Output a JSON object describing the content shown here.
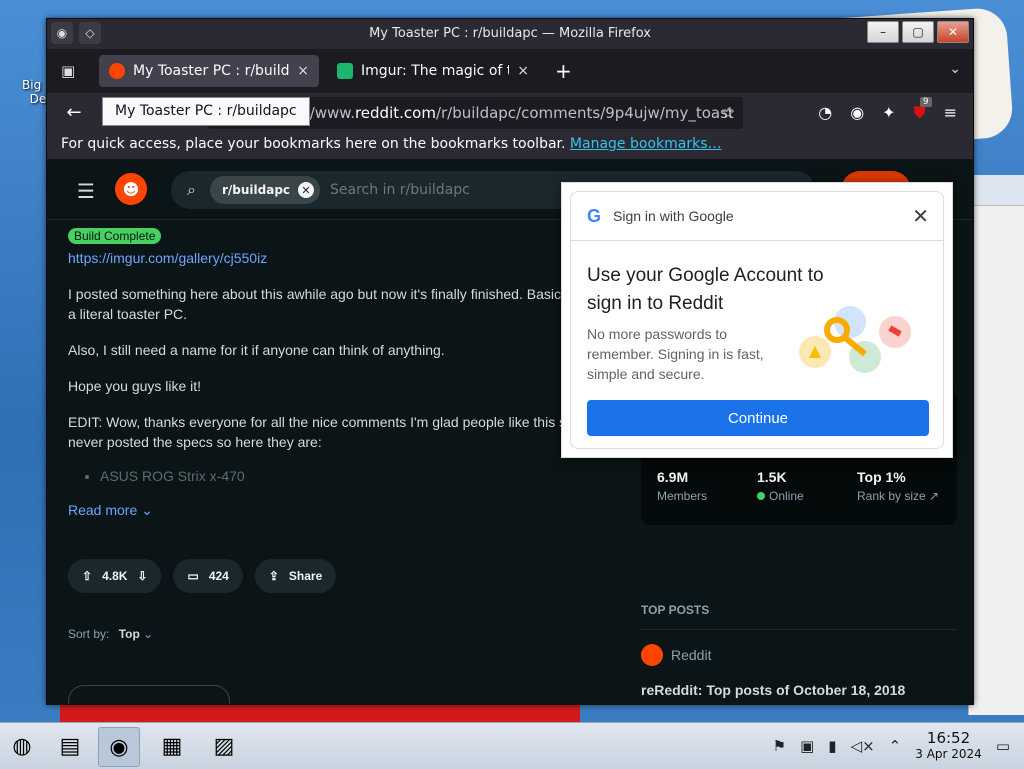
{
  "window": {
    "title": "My Toaster PC : r/buildapc — Mozilla Firefox",
    "buttons": [
      "–",
      "▢",
      "✕"
    ]
  },
  "tabs": [
    {
      "label": "My Toaster PC : r/buildapc",
      "close": "×",
      "favicon_color": "#ff4500"
    },
    {
      "label": "Imgur: The magic of the Internet",
      "close": "×",
      "favicon_color": "#1bb76e"
    }
  ],
  "new_tab": "+",
  "url": {
    "prefix": "https://www.",
    "host": "reddit.com",
    "path": "/r/buildapc/comments/9p4ujw/my_toast"
  },
  "tooltip": "My Toaster PC : r/buildapc",
  "extension_badge": "9",
  "bookmarks_bar": {
    "text": "For quick access, place your bookmarks here on the bookmarks toolbar.",
    "link": "Manage bookmarks…"
  },
  "reddit": {
    "search_chip": "r/buildapc",
    "search_placeholder": "Search in r/buildapc",
    "post": {
      "flair": "Build Complete",
      "link": "https://imgur.com/gallery/cj550iz",
      "paragraphs": [
        "I posted something here about this awhile ago but now it's finally finished. Basic",
        "a literal toaster PC.",
        "Also, I still need a name for it if anyone can think of anything.",
        "Hope you guys like it!",
        "EDIT: Wow, thanks everyone for all the nice comments I'm glad people like this s",
        "never posted the specs so here they are:"
      ],
      "spec_item": "ASUS ROG Strix x-470",
      "read_more": "Read more",
      "upvotes": "4.8K",
      "comments": "424",
      "share": "Share",
      "sort_label": "Sort by:",
      "sort_value": "Top"
    },
    "stats": {
      "members_value": "6.9M",
      "members_label": "Members",
      "online_value": "1.5K",
      "online_label": "Online",
      "rank_value": "Top 1%",
      "rank_label": "Rank by size"
    },
    "top_posts": {
      "header": "TOP POSTS",
      "author": "Reddit",
      "title": "reReddit: Top posts of October 18, 2018"
    }
  },
  "google_popup": {
    "header": "Sign in with Google",
    "title": "Use your Google Account to sign in to Reddit",
    "description": "No more passwords to remember. Signing in is fast, simple and secure.",
    "continue": "Continue"
  },
  "desktop": {
    "icon_label": "Big\nDe"
  },
  "taskbar": {
    "time": "16:52",
    "date": "3 Apr 2024"
  },
  "colors": {
    "accent": "#ff4500",
    "google_blue": "#1a73e8",
    "link": "#6ca6ff",
    "flair": "#46d160"
  }
}
